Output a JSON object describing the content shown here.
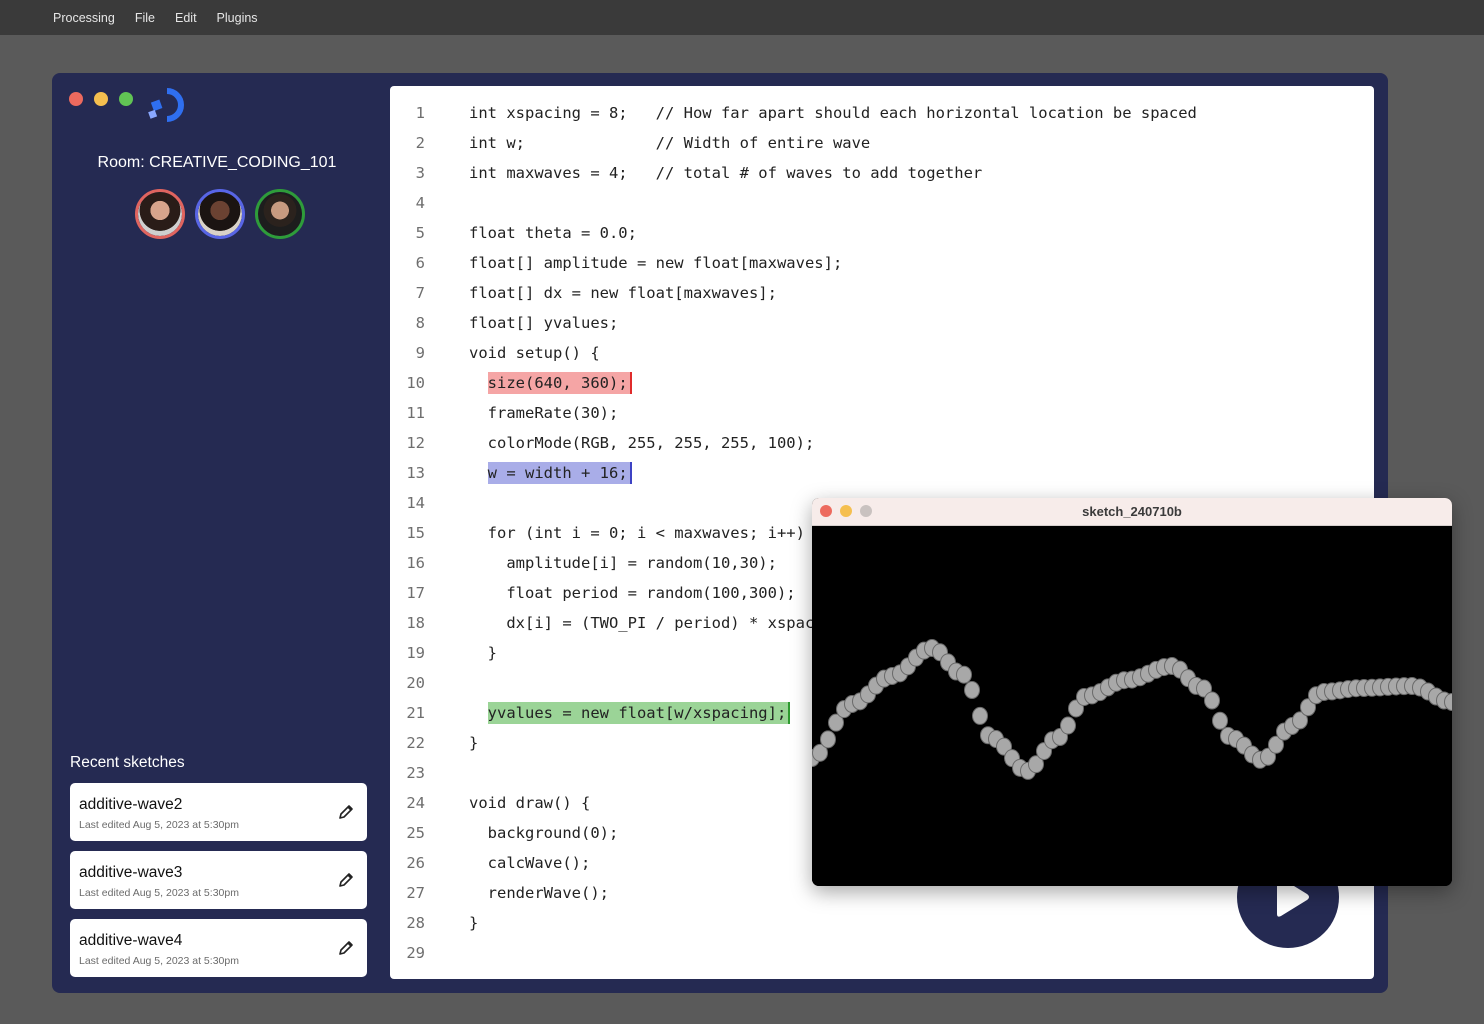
{
  "menubar": {
    "items": [
      "Processing",
      "File",
      "Edit",
      "Plugins"
    ]
  },
  "sidebar": {
    "room_label": "Room: CREATIVE_CODING_101",
    "recent_title": "Recent sketches",
    "sketches": [
      {
        "name": "additive-wave2",
        "edited": "Last edited Aug 5, 2023 at 5:30pm"
      },
      {
        "name": "additive-wave3",
        "edited": "Last edited Aug 5, 2023 at 5:30pm"
      },
      {
        "name": "additive-wave4",
        "edited": "Last edited Aug 5, 2023 at 5:30pm"
      }
    ]
  },
  "editor": {
    "lines": [
      {
        "n": "1",
        "t": "int xspacing = 8;   // How far apart should each horizontal location be spaced"
      },
      {
        "n": "2",
        "t": "int w;              // Width of entire wave"
      },
      {
        "n": "3",
        "t": "int maxwaves = 4;   // total # of waves to add together"
      },
      {
        "n": "4",
        "t": ""
      },
      {
        "n": "5",
        "t": "float theta = 0.0;"
      },
      {
        "n": "6",
        "t": "float[] amplitude = new float[maxwaves];"
      },
      {
        "n": "7",
        "t": "float[] dx = new float[maxwaves];"
      },
      {
        "n": "8",
        "t": "float[] yvalues;"
      },
      {
        "n": "9",
        "t": "void setup() {"
      },
      {
        "n": "10",
        "t": "size(640, 360);",
        "indent": "  ",
        "hl": "red"
      },
      {
        "n": "11",
        "t": "  frameRate(30);"
      },
      {
        "n": "12",
        "t": "  colorMode(RGB, 255, 255, 255, 100);"
      },
      {
        "n": "13",
        "t": "w = width + 16;",
        "indent": "  ",
        "hl": "blue"
      },
      {
        "n": "14",
        "t": ""
      },
      {
        "n": "15",
        "t": "  for (int i = 0; i < maxwaves; i++) {"
      },
      {
        "n": "16",
        "t": "    amplitude[i] = random(10,30);"
      },
      {
        "n": "17",
        "t": "    float period = random(100,300);"
      },
      {
        "n": "18",
        "t": "    dx[i] = (TWO_PI / period) * xspacing;"
      },
      {
        "n": "19",
        "t": "  }"
      },
      {
        "n": "20",
        "t": ""
      },
      {
        "n": "21",
        "t": "yvalues = new float[w/xspacing];",
        "indent": "  ",
        "hl": "green"
      },
      {
        "n": "22",
        "t": "}"
      },
      {
        "n": "23",
        "t": ""
      },
      {
        "n": "24",
        "t": "void draw() {"
      },
      {
        "n": "25",
        "t": "  background(0);"
      },
      {
        "n": "26",
        "t": "  calcWave();"
      },
      {
        "n": "27",
        "t": "  renderWave();"
      },
      {
        "n": "28",
        "t": "}"
      },
      {
        "n": "29",
        "t": ""
      }
    ]
  },
  "sketch_window": {
    "title": "sketch_240710b"
  },
  "colors": {
    "app_bg": "#252a52",
    "highlight_red": "#f5a5a5",
    "highlight_blue": "#a9ade8",
    "highlight_green": "#9bd497",
    "accent_blue": "#2f6ff0"
  },
  "icons": {
    "logo": "processing-logo",
    "edit": "pencil-icon",
    "run": "play-icon"
  }
}
